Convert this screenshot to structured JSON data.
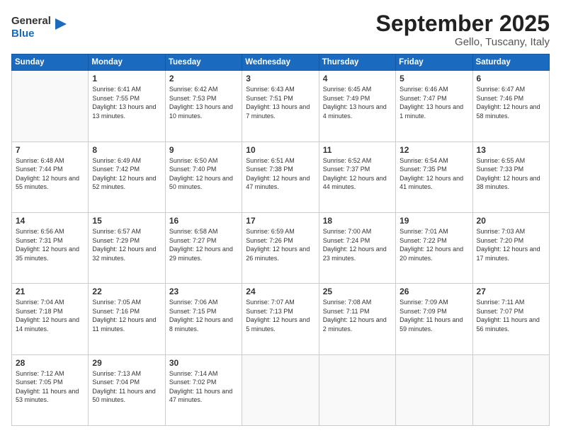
{
  "header": {
    "logo_line1": "General",
    "logo_line2": "Blue",
    "month": "September 2025",
    "location": "Gello, Tuscany, Italy"
  },
  "weekdays": [
    "Sunday",
    "Monday",
    "Tuesday",
    "Wednesday",
    "Thursday",
    "Friday",
    "Saturday"
  ],
  "weeks": [
    [
      {
        "day": "",
        "sunrise": "",
        "sunset": "",
        "daylight": ""
      },
      {
        "day": "1",
        "sunrise": "Sunrise: 6:41 AM",
        "sunset": "Sunset: 7:55 PM",
        "daylight": "Daylight: 13 hours and 13 minutes."
      },
      {
        "day": "2",
        "sunrise": "Sunrise: 6:42 AM",
        "sunset": "Sunset: 7:53 PM",
        "daylight": "Daylight: 13 hours and 10 minutes."
      },
      {
        "day": "3",
        "sunrise": "Sunrise: 6:43 AM",
        "sunset": "Sunset: 7:51 PM",
        "daylight": "Daylight: 13 hours and 7 minutes."
      },
      {
        "day": "4",
        "sunrise": "Sunrise: 6:45 AM",
        "sunset": "Sunset: 7:49 PM",
        "daylight": "Daylight: 13 hours and 4 minutes."
      },
      {
        "day": "5",
        "sunrise": "Sunrise: 6:46 AM",
        "sunset": "Sunset: 7:47 PM",
        "daylight": "Daylight: 13 hours and 1 minute."
      },
      {
        "day": "6",
        "sunrise": "Sunrise: 6:47 AM",
        "sunset": "Sunset: 7:46 PM",
        "daylight": "Daylight: 12 hours and 58 minutes."
      }
    ],
    [
      {
        "day": "7",
        "sunrise": "Sunrise: 6:48 AM",
        "sunset": "Sunset: 7:44 PM",
        "daylight": "Daylight: 12 hours and 55 minutes."
      },
      {
        "day": "8",
        "sunrise": "Sunrise: 6:49 AM",
        "sunset": "Sunset: 7:42 PM",
        "daylight": "Daylight: 12 hours and 52 minutes."
      },
      {
        "day": "9",
        "sunrise": "Sunrise: 6:50 AM",
        "sunset": "Sunset: 7:40 PM",
        "daylight": "Daylight: 12 hours and 50 minutes."
      },
      {
        "day": "10",
        "sunrise": "Sunrise: 6:51 AM",
        "sunset": "Sunset: 7:38 PM",
        "daylight": "Daylight: 12 hours and 47 minutes."
      },
      {
        "day": "11",
        "sunrise": "Sunrise: 6:52 AM",
        "sunset": "Sunset: 7:37 PM",
        "daylight": "Daylight: 12 hours and 44 minutes."
      },
      {
        "day": "12",
        "sunrise": "Sunrise: 6:54 AM",
        "sunset": "Sunset: 7:35 PM",
        "daylight": "Daylight: 12 hours and 41 minutes."
      },
      {
        "day": "13",
        "sunrise": "Sunrise: 6:55 AM",
        "sunset": "Sunset: 7:33 PM",
        "daylight": "Daylight: 12 hours and 38 minutes."
      }
    ],
    [
      {
        "day": "14",
        "sunrise": "Sunrise: 6:56 AM",
        "sunset": "Sunset: 7:31 PM",
        "daylight": "Daylight: 12 hours and 35 minutes."
      },
      {
        "day": "15",
        "sunrise": "Sunrise: 6:57 AM",
        "sunset": "Sunset: 7:29 PM",
        "daylight": "Daylight: 12 hours and 32 minutes."
      },
      {
        "day": "16",
        "sunrise": "Sunrise: 6:58 AM",
        "sunset": "Sunset: 7:27 PM",
        "daylight": "Daylight: 12 hours and 29 minutes."
      },
      {
        "day": "17",
        "sunrise": "Sunrise: 6:59 AM",
        "sunset": "Sunset: 7:26 PM",
        "daylight": "Daylight: 12 hours and 26 minutes."
      },
      {
        "day": "18",
        "sunrise": "Sunrise: 7:00 AM",
        "sunset": "Sunset: 7:24 PM",
        "daylight": "Daylight: 12 hours and 23 minutes."
      },
      {
        "day": "19",
        "sunrise": "Sunrise: 7:01 AM",
        "sunset": "Sunset: 7:22 PM",
        "daylight": "Daylight: 12 hours and 20 minutes."
      },
      {
        "day": "20",
        "sunrise": "Sunrise: 7:03 AM",
        "sunset": "Sunset: 7:20 PM",
        "daylight": "Daylight: 12 hours and 17 minutes."
      }
    ],
    [
      {
        "day": "21",
        "sunrise": "Sunrise: 7:04 AM",
        "sunset": "Sunset: 7:18 PM",
        "daylight": "Daylight: 12 hours and 14 minutes."
      },
      {
        "day": "22",
        "sunrise": "Sunrise: 7:05 AM",
        "sunset": "Sunset: 7:16 PM",
        "daylight": "Daylight: 12 hours and 11 minutes."
      },
      {
        "day": "23",
        "sunrise": "Sunrise: 7:06 AM",
        "sunset": "Sunset: 7:15 PM",
        "daylight": "Daylight: 12 hours and 8 minutes."
      },
      {
        "day": "24",
        "sunrise": "Sunrise: 7:07 AM",
        "sunset": "Sunset: 7:13 PM",
        "daylight": "Daylight: 12 hours and 5 minutes."
      },
      {
        "day": "25",
        "sunrise": "Sunrise: 7:08 AM",
        "sunset": "Sunset: 7:11 PM",
        "daylight": "Daylight: 12 hours and 2 minutes."
      },
      {
        "day": "26",
        "sunrise": "Sunrise: 7:09 AM",
        "sunset": "Sunset: 7:09 PM",
        "daylight": "Daylight: 11 hours and 59 minutes."
      },
      {
        "day": "27",
        "sunrise": "Sunrise: 7:11 AM",
        "sunset": "Sunset: 7:07 PM",
        "daylight": "Daylight: 11 hours and 56 minutes."
      }
    ],
    [
      {
        "day": "28",
        "sunrise": "Sunrise: 7:12 AM",
        "sunset": "Sunset: 7:05 PM",
        "daylight": "Daylight: 11 hours and 53 minutes."
      },
      {
        "day": "29",
        "sunrise": "Sunrise: 7:13 AM",
        "sunset": "Sunset: 7:04 PM",
        "daylight": "Daylight: 11 hours and 50 minutes."
      },
      {
        "day": "30",
        "sunrise": "Sunrise: 7:14 AM",
        "sunset": "Sunset: 7:02 PM",
        "daylight": "Daylight: 11 hours and 47 minutes."
      },
      {
        "day": "",
        "sunrise": "",
        "sunset": "",
        "daylight": ""
      },
      {
        "day": "",
        "sunrise": "",
        "sunset": "",
        "daylight": ""
      },
      {
        "day": "",
        "sunrise": "",
        "sunset": "",
        "daylight": ""
      },
      {
        "day": "",
        "sunrise": "",
        "sunset": "",
        "daylight": ""
      }
    ]
  ]
}
